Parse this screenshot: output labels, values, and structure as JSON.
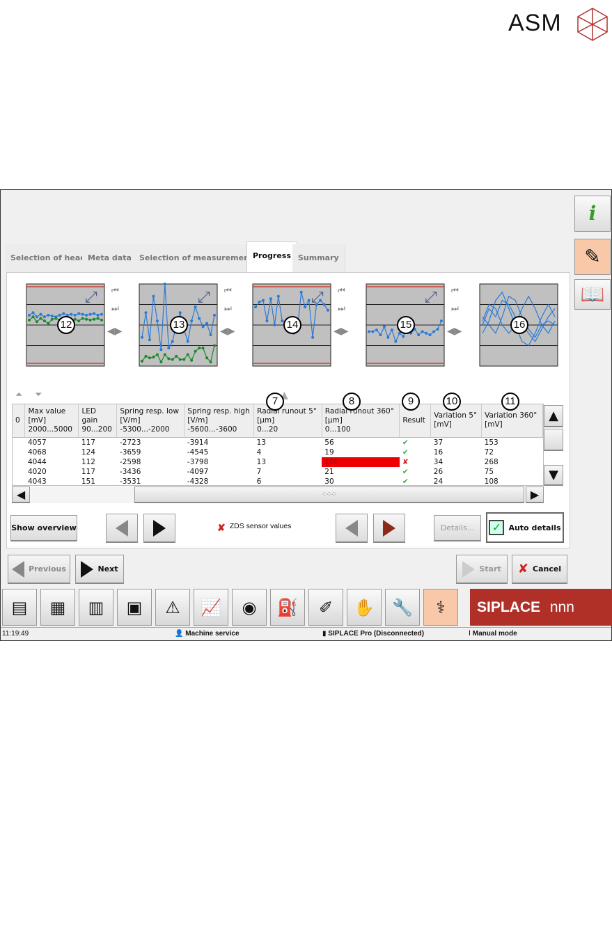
{
  "brand": {
    "logo_text": "ASM",
    "siplace": "SIPLACE",
    "siplace_mark": "nnn"
  },
  "tabs": [
    {
      "label": "Selection of head"
    },
    {
      "label": "Meta data"
    },
    {
      "label": "Selection of measurements"
    },
    {
      "label": "Progress",
      "active": true
    },
    {
      "label": "Summary"
    }
  ],
  "thumbnails": [
    {
      "callout": "12",
      "series": [
        [
          0.62,
          0.65,
          0.6,
          0.63,
          0.6,
          0.62,
          0.61,
          0.6,
          0.62,
          0.64,
          0.62,
          0.63,
          0.62,
          0.64,
          0.63,
          0.62,
          0.63,
          0.64,
          0.62,
          0.63
        ],
        [
          0.56,
          0.6,
          0.54,
          0.58,
          0.55,
          0.52,
          0.57,
          0.58,
          0.56,
          0.55,
          0.58,
          0.56,
          0.57,
          0.55,
          0.58,
          0.57,
          0.56,
          0.57,
          0.58,
          0.56
        ]
      ],
      "colors": [
        "#2a7ad8",
        "#1a8a2a"
      ],
      "limits": true
    },
    {
      "callout": "13",
      "series": [
        [
          0.35,
          0.65,
          0.32,
          0.85,
          0.55,
          0.2,
          1.0,
          0.22,
          0.3,
          0.5,
          0.65,
          0.45,
          0.3,
          0.55,
          0.72,
          0.58,
          0.48,
          0.52,
          0.38,
          0.62
        ],
        [
          0.06,
          0.12,
          0.1,
          0.11,
          0.14,
          0.05,
          0.14,
          0.09,
          0.08,
          0.12,
          0.08,
          0.08,
          0.14,
          0.07,
          0.18,
          0.22,
          0.22,
          0.1,
          0.05,
          0.25
        ]
      ],
      "colors": [
        "#2a7ad8",
        "#1a8a2a"
      ],
      "limits": false
    },
    {
      "callout": "14",
      "series": [
        [
          0.72,
          0.78,
          0.8,
          0.55,
          0.82,
          0.5,
          0.85,
          0.55,
          0.52,
          0.55,
          0.4,
          0.45,
          0.9,
          0.72,
          0.8,
          0.35,
          0.75,
          0.8,
          0.75,
          0.68
        ]
      ],
      "colors": [
        "#2a7ad8"
      ],
      "limits": true
    },
    {
      "callout": "15",
      "series": [
        [
          0.42,
          0.42,
          0.44,
          0.38,
          0.48,
          0.35,
          0.44,
          0.3,
          0.4,
          0.36,
          0.5,
          0.4,
          0.45,
          0.38,
          0.42,
          0.4,
          0.38,
          0.42,
          0.45,
          0.55
        ]
      ],
      "colors": [
        "#2a7ad8"
      ],
      "limits": true
    },
    {
      "callout": "16",
      "series": [
        [
          0.5,
          0.7,
          0.6,
          0.8,
          0.75,
          0.6,
          0.5,
          0.4,
          0.3,
          0.45,
          0.6,
          0.7
        ],
        [
          0.4,
          0.55,
          0.8,
          0.9,
          0.7,
          0.5,
          0.3,
          0.25,
          0.4,
          0.6,
          0.75,
          0.6
        ],
        [
          0.6,
          0.5,
          0.4,
          0.6,
          0.85,
          0.8,
          0.6,
          0.45,
          0.35,
          0.5,
          0.55,
          0.5
        ],
        [
          0.55,
          0.75,
          0.7,
          0.5,
          0.4,
          0.5,
          0.7,
          0.85,
          0.7,
          0.5,
          0.4,
          0.55
        ]
      ],
      "colors": [
        "#2a7ad8",
        "#2a7ad8",
        "#2a7ad8",
        "#2a7ad8"
      ],
      "limits": false
    }
  ],
  "table": {
    "columns": [
      {
        "l1": "",
        "l2": "",
        "l3": "0"
      },
      {
        "l1": "Max value",
        "l2": "[mV]",
        "l3": "2000...5000"
      },
      {
        "l1": "LED gain",
        "l2": "90...200",
        "l3": ""
      },
      {
        "l1": "Spring resp. low",
        "l2": "[V/m]",
        "l3": "-5300...-2000"
      },
      {
        "l1": "Spring resp. high",
        "l2": "[V/m]",
        "l3": "-5600...-3600"
      },
      {
        "l1": "Radial runout 5°",
        "l2": "[µm]",
        "l3": "0...20"
      },
      {
        "l1": "Radial runout 360°",
        "l2": "[µm]",
        "l3": "0...100"
      },
      {
        "l1": "Result",
        "l2": "",
        "l3": ""
      },
      {
        "l1": "Variation 5°",
        "l2": "[mV]",
        "l3": ""
      },
      {
        "l1": "Variation 360°",
        "l2": "[mV]",
        "l3": ""
      }
    ],
    "callouts": [
      "7",
      "8",
      "9",
      "10",
      "11"
    ],
    "rows": [
      [
        "",
        "4057",
        "117",
        "-2723",
        "-3914",
        "13",
        "56",
        "pass",
        "37",
        "153"
      ],
      [
        "",
        "4068",
        "124",
        "-3659",
        "-4545",
        "4",
        "19",
        "pass",
        "16",
        "72"
      ],
      [
        "",
        "4044",
        "112",
        "-2598",
        "-3798",
        "13",
        "100",
        "fail",
        "34",
        "268"
      ],
      [
        "",
        "4020",
        "117",
        "-3436",
        "-4097",
        "7",
        "21",
        "pass",
        "26",
        "75"
      ],
      [
        "",
        "4043",
        "151",
        "-3531",
        "-4328",
        "6",
        "30",
        "pass",
        "24",
        "108"
      ]
    ],
    "error_color": "#ee0000"
  },
  "controls": {
    "show_overview": "Show overview",
    "zds_label": "ZDS sensor values",
    "details": "Details...",
    "auto_details": "Auto details",
    "auto_details_checked": true
  },
  "wizard": {
    "previous": "Previous",
    "next": "Next",
    "start": "Start",
    "cancel": "Cancel"
  },
  "toolbar_icons": [
    "boards-stack-icon",
    "grid-green-icon",
    "bar-chart-icon",
    "pcb-icon",
    "warning-docs-icon",
    "line-chart-icon",
    "camera-icon",
    "oil-can-icon",
    "screwdriver-icon",
    "hand-gear-icon",
    "wrench-icon",
    "stethoscope-icon"
  ],
  "status": {
    "time": "11:19:49",
    "user": "Machine service",
    "connection": "SIPLACE Pro (Disconnected)",
    "mode": "Manual mode"
  },
  "accent": "#b03028"
}
